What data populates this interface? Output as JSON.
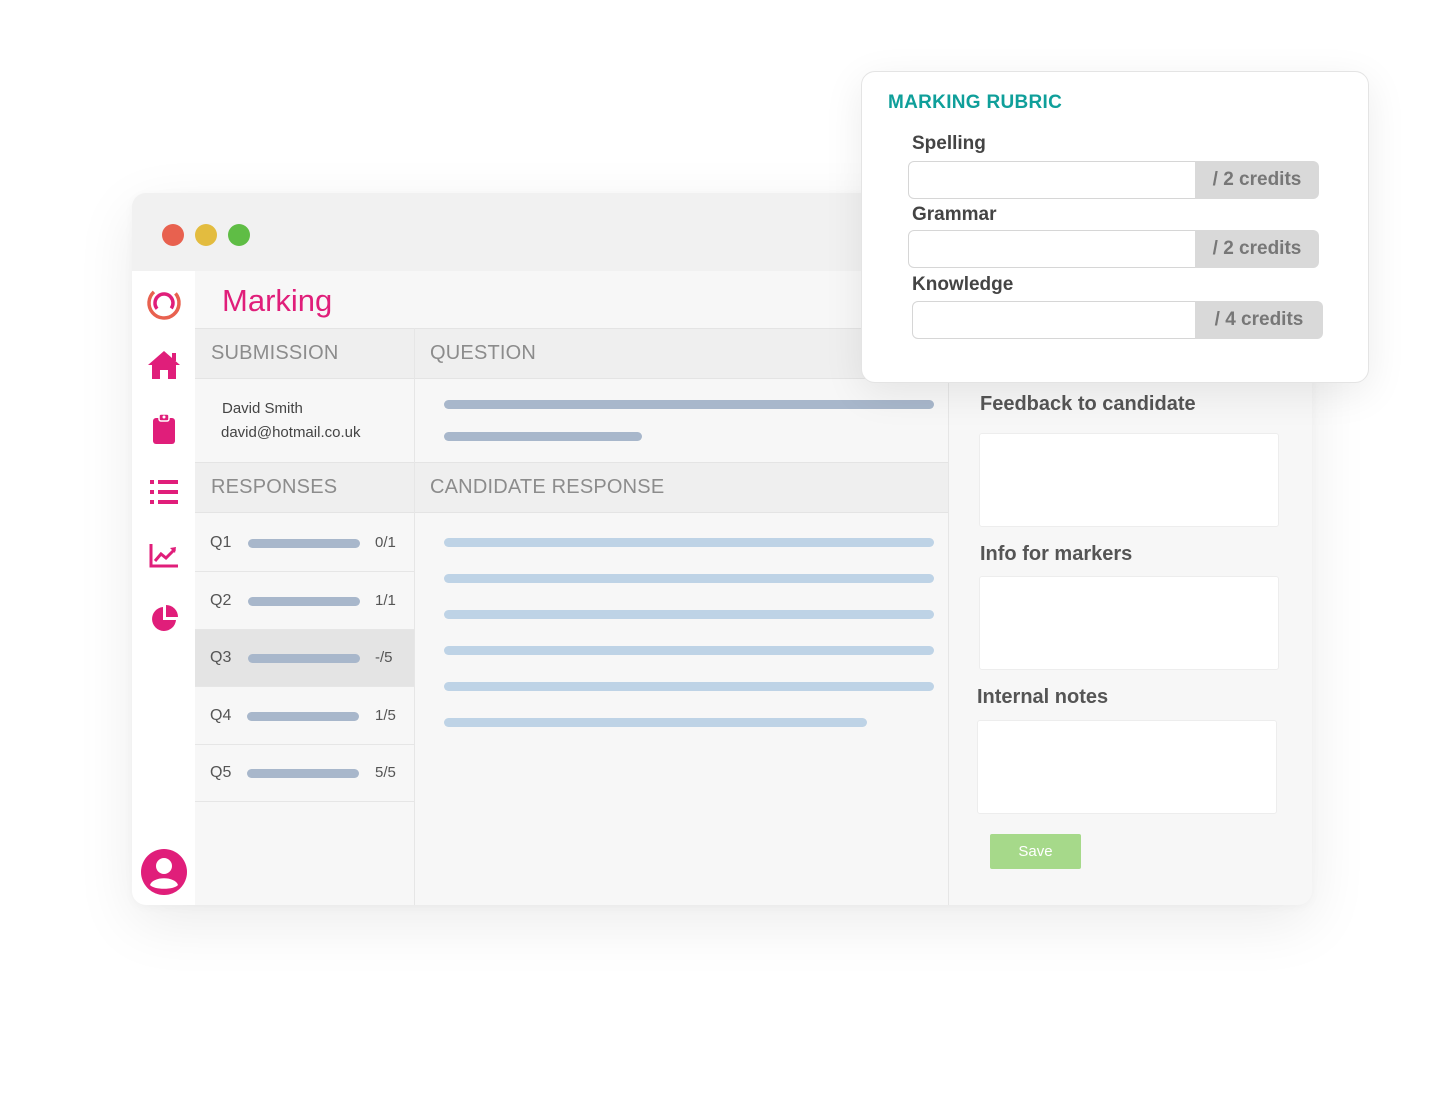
{
  "window": {
    "traffic_lights": [
      "close",
      "minimize",
      "maximize"
    ],
    "colors": {
      "close": "#e8614f",
      "minimize": "#e3bc3f",
      "maximize": "#5fbd45"
    }
  },
  "sidebar": {
    "items": [
      {
        "icon": "app-logo-icon"
      },
      {
        "icon": "home-icon"
      },
      {
        "icon": "clipboard-icon"
      },
      {
        "icon": "list-icon"
      },
      {
        "icon": "line-chart-icon"
      },
      {
        "icon": "pie-chart-icon"
      }
    ],
    "profile_icon": "user-profile-icon",
    "accent_color": "#e01e7a"
  },
  "page": {
    "title": "Marking"
  },
  "submission": {
    "header": "SUBMISSION",
    "name": "David Smith",
    "email": "david@hotmail.co.uk"
  },
  "question": {
    "header": "QUESTION"
  },
  "responses": {
    "header": "RESPONSES",
    "items": [
      {
        "label": "Q1",
        "score": "0/1"
      },
      {
        "label": "Q2",
        "score": "1/1"
      },
      {
        "label": "Q3",
        "score": "-/5"
      },
      {
        "label": "Q4",
        "score": "1/5"
      },
      {
        "label": "Q5",
        "score": "5/5"
      }
    ],
    "active_index": 2
  },
  "candidate_response": {
    "header": "CANDIDATE RESPONSE"
  },
  "right_panel": {
    "feedback_label": "Feedback to candidate",
    "info_label": "Info for markers",
    "notes_label": "Internal notes",
    "save_label": "Save",
    "save_color": "#a6d98a"
  },
  "rubric": {
    "title": "MARKING RUBRIC",
    "title_color": "#0f9f9a",
    "criteria": [
      {
        "label": "Spelling",
        "value": "",
        "suffix": "/ 2 credits"
      },
      {
        "label": "Grammar",
        "value": "",
        "suffix": "/ 2 credits"
      },
      {
        "label": "Knowledge",
        "value": "",
        "suffix": "/ 4 credits"
      }
    ]
  }
}
